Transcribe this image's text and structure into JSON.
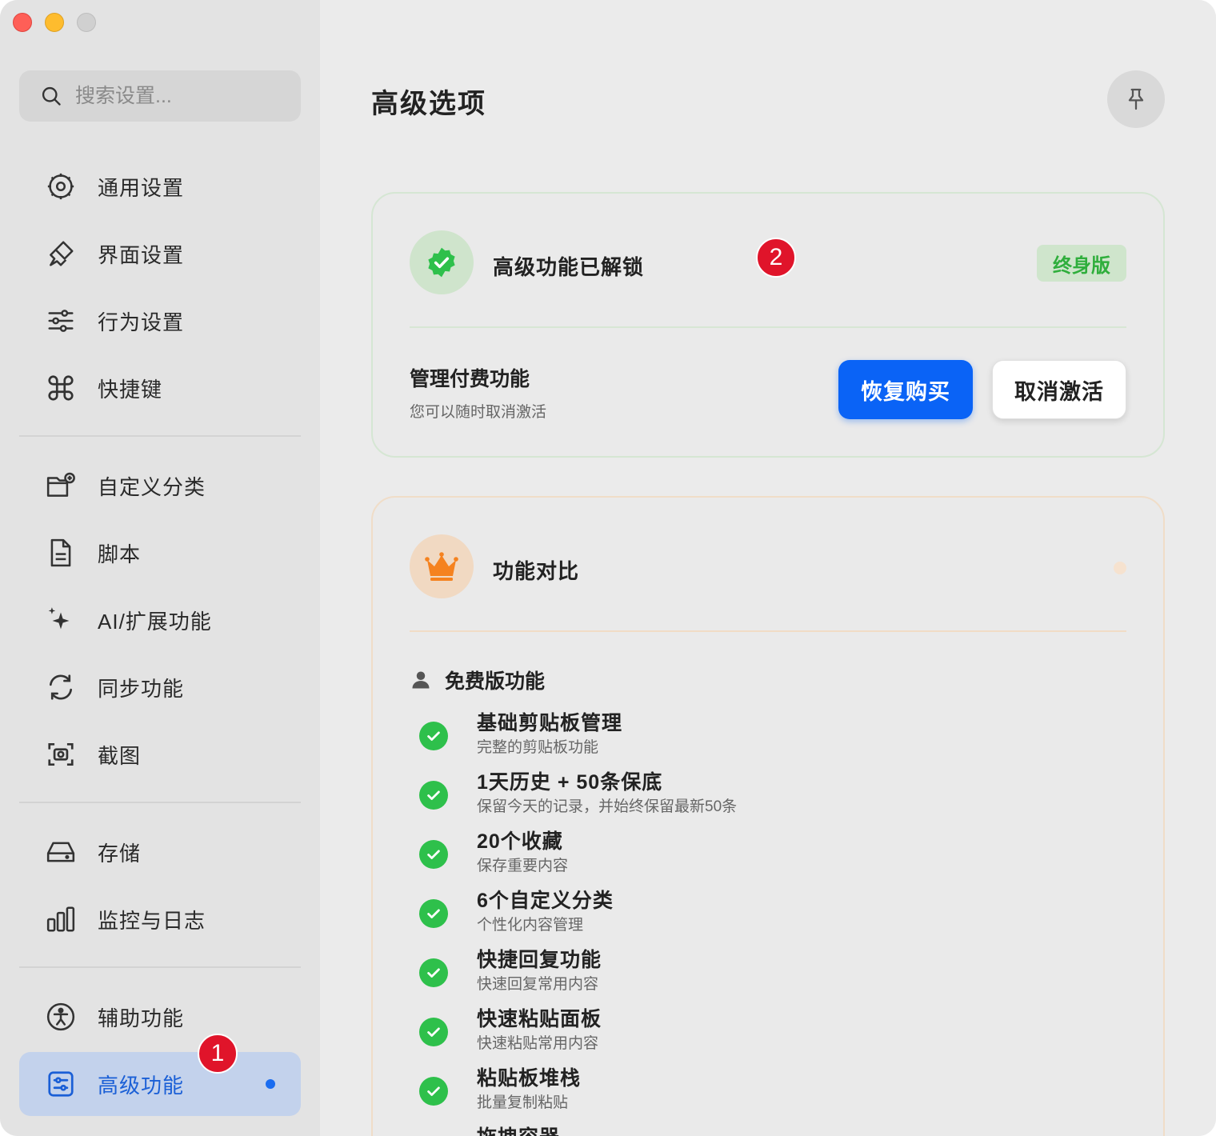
{
  "sidebar": {
    "search_placeholder": "搜索设置...",
    "groups": [
      [
        {
          "label": "通用设置",
          "icon": "gear-icon"
        },
        {
          "label": "界面设置",
          "icon": "paintbrush-icon"
        },
        {
          "label": "行为设置",
          "icon": "sliders-icon"
        },
        {
          "label": "快捷键",
          "icon": "command-key-icon"
        }
      ],
      [
        {
          "label": "自定义分类",
          "icon": "folder-plus-icon"
        },
        {
          "label": "脚本",
          "icon": "document-icon"
        },
        {
          "label": "AI/扩展功能",
          "icon": "sparkles-icon"
        },
        {
          "label": "同步功能",
          "icon": "sync-icon"
        },
        {
          "label": "截图",
          "icon": "screenshot-icon"
        }
      ],
      [
        {
          "label": "存储",
          "icon": "drive-icon"
        },
        {
          "label": "监控与日志",
          "icon": "bar-chart-icon"
        }
      ],
      [
        {
          "label": "辅助功能",
          "icon": "accessibility-icon"
        },
        {
          "label": "高级功能",
          "icon": "settings-card-icon",
          "active": true
        }
      ]
    ]
  },
  "annotations": [
    "1",
    "2"
  ],
  "main": {
    "title": "高级选项",
    "status_card": {
      "title": "高级功能已解锁",
      "badge": "终身版",
      "manage_title": "管理付费功能",
      "manage_sub": "您可以随时取消激活",
      "restore_label": "恢复购买",
      "deactivate_label": "取消激活"
    },
    "compare_card": {
      "title": "功能对比",
      "free_section": "免费版功能",
      "features": [
        {
          "title": "基础剪贴板管理",
          "sub": "完整的剪贴板功能"
        },
        {
          "title": "1天历史 + 50条保底",
          "sub": "保留今天的记录，并始终保留最新50条"
        },
        {
          "title": "20个收藏",
          "sub": "保存重要内容"
        },
        {
          "title": "6个自定义分类",
          "sub": "个性化内容管理"
        },
        {
          "title": "快捷回复功能",
          "sub": "快速回复常用内容"
        },
        {
          "title": "快速粘贴面板",
          "sub": "快速粘贴常用内容"
        },
        {
          "title": "粘贴板堆栈",
          "sub": "批量复制粘贴"
        },
        {
          "title": "拖拽容器",
          "sub": ""
        }
      ]
    }
  },
  "colors": {
    "accent": "#0a63f6",
    "success": "#2ec04b",
    "badge_red": "#e0142a",
    "active_bg": "#c3d2ec"
  }
}
